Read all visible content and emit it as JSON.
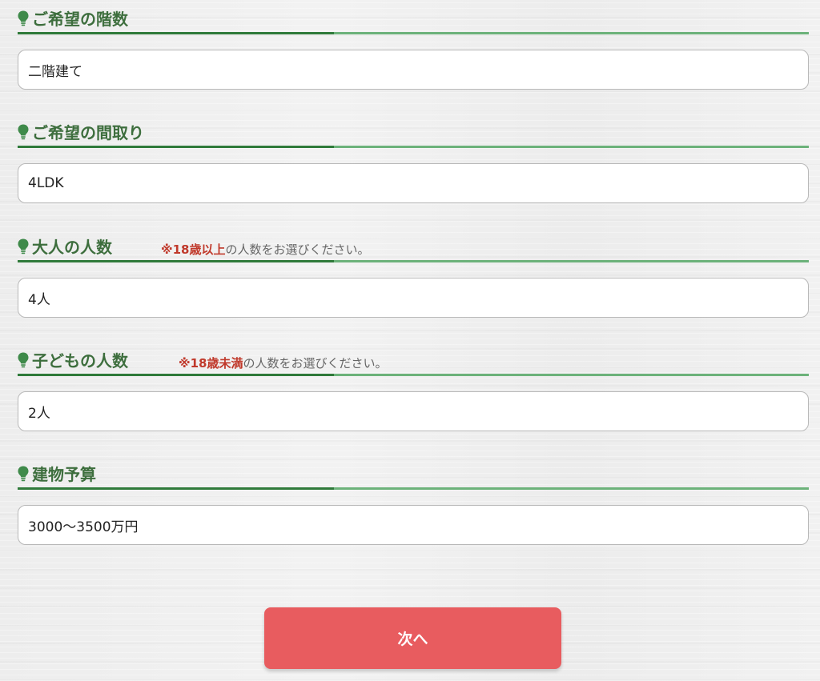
{
  "form": {
    "floors": {
      "label": "ご希望の階数",
      "value": "二階建て"
    },
    "layout": {
      "label": "ご希望の間取り",
      "value": "4LDK"
    },
    "adults": {
      "label": "大人の人数",
      "note_prefix": "※",
      "note_emphasis": "※18歳以上",
      "note_rest": "の人数をお選びください。",
      "value": "4人"
    },
    "children": {
      "label": "子どもの人数",
      "note_emphasis": "※18歳未満",
      "note_rest": "の人数をお選びください。",
      "value": "2人"
    },
    "budget": {
      "label": "建物予算",
      "value": "3000～3500万円"
    }
  },
  "next_button": {
    "label": "次へ"
  },
  "colors": {
    "heading": "#3d6e3d",
    "rule_dark": "#2f7a3a",
    "rule_light": "#6cb27a",
    "note_emphasis": "#c0392b",
    "button": "#e85c5f"
  },
  "icons": {
    "heading": "lightbulb-icon"
  }
}
